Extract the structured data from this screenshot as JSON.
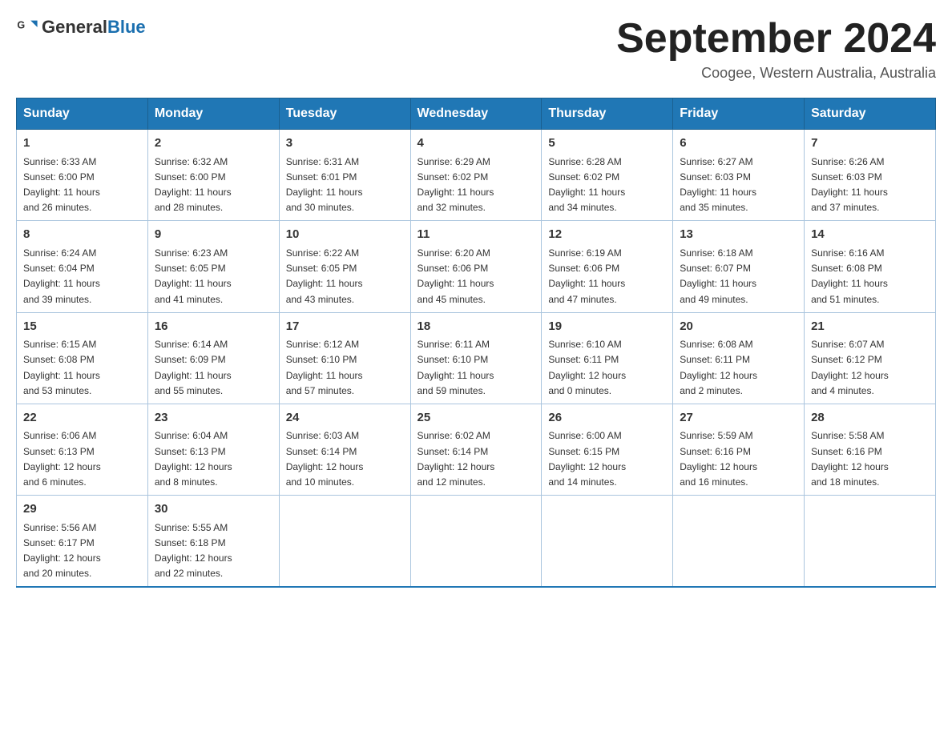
{
  "header": {
    "logo_general": "General",
    "logo_blue": "Blue",
    "title": "September 2024",
    "subtitle": "Coogee, Western Australia, Australia"
  },
  "days_of_week": [
    "Sunday",
    "Monday",
    "Tuesday",
    "Wednesday",
    "Thursday",
    "Friday",
    "Saturday"
  ],
  "weeks": [
    [
      {
        "date": "1",
        "sunrise": "6:33 AM",
        "sunset": "6:00 PM",
        "daylight": "11 hours and 26 minutes."
      },
      {
        "date": "2",
        "sunrise": "6:32 AM",
        "sunset": "6:00 PM",
        "daylight": "11 hours and 28 minutes."
      },
      {
        "date": "3",
        "sunrise": "6:31 AM",
        "sunset": "6:01 PM",
        "daylight": "11 hours and 30 minutes."
      },
      {
        "date": "4",
        "sunrise": "6:29 AM",
        "sunset": "6:02 PM",
        "daylight": "11 hours and 32 minutes."
      },
      {
        "date": "5",
        "sunrise": "6:28 AM",
        "sunset": "6:02 PM",
        "daylight": "11 hours and 34 minutes."
      },
      {
        "date": "6",
        "sunrise": "6:27 AM",
        "sunset": "6:03 PM",
        "daylight": "11 hours and 35 minutes."
      },
      {
        "date": "7",
        "sunrise": "6:26 AM",
        "sunset": "6:03 PM",
        "daylight": "11 hours and 37 minutes."
      }
    ],
    [
      {
        "date": "8",
        "sunrise": "6:24 AM",
        "sunset": "6:04 PM",
        "daylight": "11 hours and 39 minutes."
      },
      {
        "date": "9",
        "sunrise": "6:23 AM",
        "sunset": "6:05 PM",
        "daylight": "11 hours and 41 minutes."
      },
      {
        "date": "10",
        "sunrise": "6:22 AM",
        "sunset": "6:05 PM",
        "daylight": "11 hours and 43 minutes."
      },
      {
        "date": "11",
        "sunrise": "6:20 AM",
        "sunset": "6:06 PM",
        "daylight": "11 hours and 45 minutes."
      },
      {
        "date": "12",
        "sunrise": "6:19 AM",
        "sunset": "6:06 PM",
        "daylight": "11 hours and 47 minutes."
      },
      {
        "date": "13",
        "sunrise": "6:18 AM",
        "sunset": "6:07 PM",
        "daylight": "11 hours and 49 minutes."
      },
      {
        "date": "14",
        "sunrise": "6:16 AM",
        "sunset": "6:08 PM",
        "daylight": "11 hours and 51 minutes."
      }
    ],
    [
      {
        "date": "15",
        "sunrise": "6:15 AM",
        "sunset": "6:08 PM",
        "daylight": "11 hours and 53 minutes."
      },
      {
        "date": "16",
        "sunrise": "6:14 AM",
        "sunset": "6:09 PM",
        "daylight": "11 hours and 55 minutes."
      },
      {
        "date": "17",
        "sunrise": "6:12 AM",
        "sunset": "6:10 PM",
        "daylight": "11 hours and 57 minutes."
      },
      {
        "date": "18",
        "sunrise": "6:11 AM",
        "sunset": "6:10 PM",
        "daylight": "11 hours and 59 minutes."
      },
      {
        "date": "19",
        "sunrise": "6:10 AM",
        "sunset": "6:11 PM",
        "daylight": "12 hours and 0 minutes."
      },
      {
        "date": "20",
        "sunrise": "6:08 AM",
        "sunset": "6:11 PM",
        "daylight": "12 hours and 2 minutes."
      },
      {
        "date": "21",
        "sunrise": "6:07 AM",
        "sunset": "6:12 PM",
        "daylight": "12 hours and 4 minutes."
      }
    ],
    [
      {
        "date": "22",
        "sunrise": "6:06 AM",
        "sunset": "6:13 PM",
        "daylight": "12 hours and 6 minutes."
      },
      {
        "date": "23",
        "sunrise": "6:04 AM",
        "sunset": "6:13 PM",
        "daylight": "12 hours and 8 minutes."
      },
      {
        "date": "24",
        "sunrise": "6:03 AM",
        "sunset": "6:14 PM",
        "daylight": "12 hours and 10 minutes."
      },
      {
        "date": "25",
        "sunrise": "6:02 AM",
        "sunset": "6:14 PM",
        "daylight": "12 hours and 12 minutes."
      },
      {
        "date": "26",
        "sunrise": "6:00 AM",
        "sunset": "6:15 PM",
        "daylight": "12 hours and 14 minutes."
      },
      {
        "date": "27",
        "sunrise": "5:59 AM",
        "sunset": "6:16 PM",
        "daylight": "12 hours and 16 minutes."
      },
      {
        "date": "28",
        "sunrise": "5:58 AM",
        "sunset": "6:16 PM",
        "daylight": "12 hours and 18 minutes."
      }
    ],
    [
      {
        "date": "29",
        "sunrise": "5:56 AM",
        "sunset": "6:17 PM",
        "daylight": "12 hours and 20 minutes."
      },
      {
        "date": "30",
        "sunrise": "5:55 AM",
        "sunset": "6:18 PM",
        "daylight": "12 hours and 22 minutes."
      },
      null,
      null,
      null,
      null,
      null
    ]
  ],
  "labels": {
    "sunrise": "Sunrise:",
    "sunset": "Sunset:",
    "daylight": "Daylight:"
  }
}
